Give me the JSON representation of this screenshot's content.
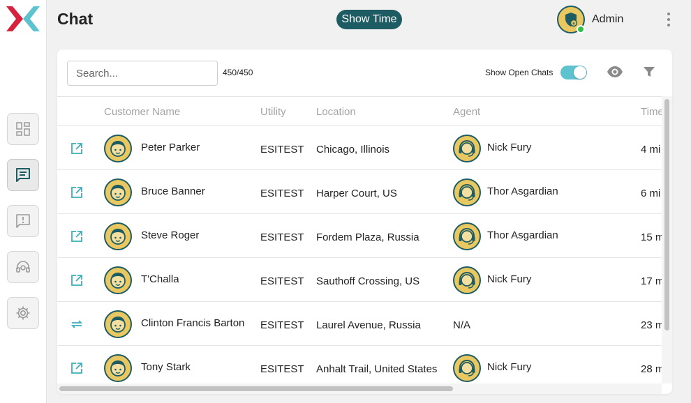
{
  "header": {
    "title": "Chat",
    "show_time_label": "Show Time",
    "user_name": "Admin",
    "user_status": "online"
  },
  "sidebar": {
    "items": [
      {
        "name": "dashboard",
        "icon": "dashboard-icon",
        "active": false
      },
      {
        "name": "chat",
        "icon": "chat-icon",
        "active": true
      },
      {
        "name": "feedback",
        "icon": "feedback-icon",
        "active": false
      },
      {
        "name": "agent",
        "icon": "headset-icon",
        "active": false
      },
      {
        "name": "settings",
        "icon": "gear-icon",
        "active": false
      }
    ]
  },
  "toolbar": {
    "search_placeholder": "Search...",
    "count": "450/450",
    "show_open_chats_label": "Show Open Chats",
    "show_open_chats_on": true
  },
  "table": {
    "columns": [
      "Customer Name",
      "Utility",
      "Location",
      "Agent",
      "Time"
    ],
    "rows": [
      {
        "action": "open-external-icon",
        "customer": "Peter Parker",
        "utility": "ESITEST",
        "location": "Chicago, Illinois",
        "agent": "Nick Fury",
        "has_agent": true,
        "time": "4 mi"
      },
      {
        "action": "open-external-icon",
        "customer": "Bruce Banner",
        "utility": "ESITEST",
        "location": "Harper Court, US",
        "agent": "Thor Asgardian",
        "has_agent": true,
        "time": "6 mi"
      },
      {
        "action": "open-external-icon",
        "customer": "Steve Roger",
        "utility": "ESITEST",
        "location": "Fordem Plaza, Russia",
        "agent": "Thor Asgardian",
        "has_agent": true,
        "time": "15 m"
      },
      {
        "action": "open-external-icon",
        "customer": "T'Challa",
        "utility": "ESITEST",
        "location": "Sauthoff Crossing, US",
        "agent": "Nick Fury",
        "has_agent": true,
        "time": "17 m"
      },
      {
        "action": "transfer-icon",
        "customer": "Clinton Francis Barton",
        "utility": "ESITEST",
        "location": "Laurel Avenue, Russia",
        "agent": "N/A",
        "has_agent": false,
        "time": "23 m"
      },
      {
        "action": "open-external-icon",
        "customer": "Tony Stark",
        "utility": "ESITEST",
        "location": "Anhalt Trail, United States",
        "agent": "Nick Fury",
        "has_agent": true,
        "time": "28 m"
      }
    ]
  },
  "colors": {
    "brand_red": "#d6223e",
    "brand_teal": "#5fc3cf",
    "dark_teal": "#1e5c63",
    "avatar_yellow": "#e9c862"
  }
}
